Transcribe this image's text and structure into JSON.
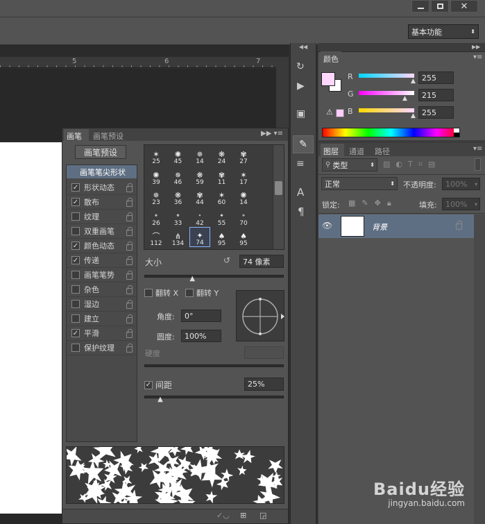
{
  "workspace": {
    "selected": "基本功能"
  },
  "ruler": {
    "ticks": [
      "5",
      "6",
      "7"
    ]
  },
  "brush_panel": {
    "tabs": [
      "画笔",
      "画笔预设"
    ],
    "preset_button": "画笔预设",
    "tip_shape_label": "画笔笔尖形状",
    "options": [
      {
        "label": "形状动态",
        "checked": true
      },
      {
        "label": "散布",
        "checked": true
      },
      {
        "label": "纹理",
        "checked": false
      },
      {
        "label": "双重画笔",
        "checked": false
      },
      {
        "label": "颜色动态",
        "checked": true
      },
      {
        "label": "传递",
        "checked": true
      },
      {
        "label": "画笔笔势",
        "checked": false
      },
      {
        "label": "杂色",
        "checked": false
      },
      {
        "label": "湿边",
        "checked": false
      },
      {
        "label": "建立",
        "checked": false
      },
      {
        "label": "平滑",
        "checked": true
      },
      {
        "label": "保护纹理",
        "checked": false
      }
    ],
    "brush_sizes": [
      [
        "25",
        "45",
        "14",
        "24",
        "27"
      ],
      [
        "39",
        "46",
        "59",
        "11",
        "17"
      ],
      [
        "23",
        "36",
        "44",
        "60",
        "14"
      ],
      [
        "26",
        "33",
        "42",
        "55",
        "70"
      ],
      [
        "112",
        "134",
        "74",
        "95",
        "95"
      ]
    ],
    "size_label": "大小",
    "size_value": "74 像素",
    "size_fraction": 0.35,
    "flip_x": "翻转 X",
    "flip_y": "翻转 Y",
    "angle_label": "角度:",
    "angle_value": "0°",
    "roundness_label": "圆度:",
    "roundness_value": "100%",
    "hardness_label": "硬度",
    "spacing_label": "间距",
    "spacing_value": "25%",
    "spacing_fraction": 0.12
  },
  "color_panel": {
    "tab": "颜色",
    "r_label": "R",
    "r_value": "255",
    "g_label": "G",
    "g_value": "215",
    "b_label": "B",
    "b_value": "255",
    "foreground": "#ffd7ff"
  },
  "layers_panel": {
    "tabs": [
      "图层",
      "通道",
      "路径"
    ],
    "filter_kind": "类型",
    "blend_mode": "正常",
    "opacity_label": "不透明度:",
    "opacity_value": "100%",
    "lock_label": "锁定:",
    "fill_label": "填充:",
    "fill_value": "100%",
    "layer_name": "背景"
  },
  "watermark": {
    "brand": "Baidu经验",
    "url": "jingyan.baidu.com"
  }
}
